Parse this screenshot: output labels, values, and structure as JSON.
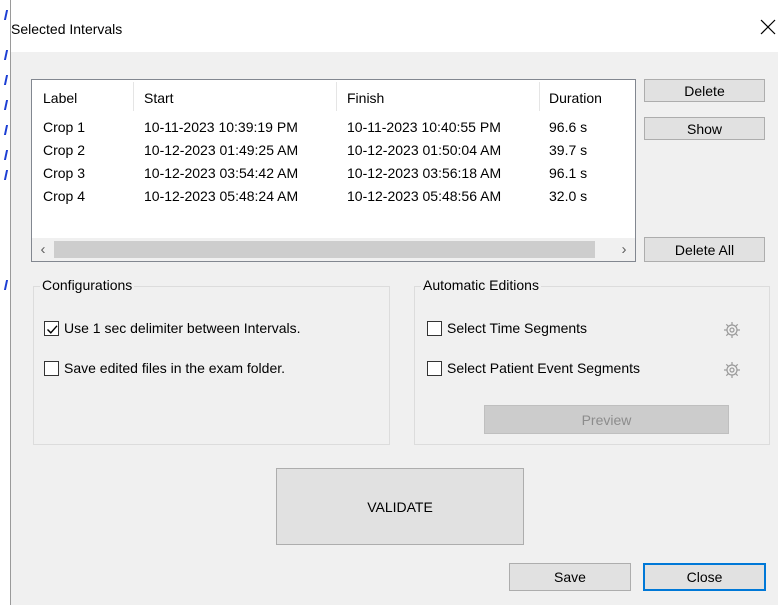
{
  "window": {
    "title": "Selected Intervals"
  },
  "intervals": {
    "columns": [
      "Label",
      "Start",
      "Finish",
      "Duration"
    ],
    "rows": [
      {
        "label": "Crop 1",
        "start": "10-11-2023 10:39:19 PM",
        "finish": "10-11-2023 10:40:55 PM",
        "duration": "96.6 s"
      },
      {
        "label": "Crop 2",
        "start": "10-12-2023 01:49:25 AM",
        "finish": "10-12-2023 01:50:04 AM",
        "duration": "39.7 s"
      },
      {
        "label": "Crop 3",
        "start": "10-12-2023 03:54:42 AM",
        "finish": "10-12-2023 03:56:18 AM",
        "duration": "96.1 s"
      },
      {
        "label": "Crop 4",
        "start": "10-12-2023 05:48:24 AM",
        "finish": "10-12-2023 05:48:56 AM",
        "duration": "32.0 s"
      }
    ]
  },
  "buttons": {
    "delete": "Delete",
    "show": "Show",
    "delete_all": "Delete All",
    "preview": "Preview",
    "validate": "VALIDATE",
    "save": "Save",
    "close": "Close"
  },
  "configurations": {
    "title": "Configurations",
    "use_delimiter": {
      "label": "Use 1 sec delimiter between Intervals.",
      "checked": true
    },
    "save_in_exam_folder": {
      "label": "Save edited files in the exam folder.",
      "checked": false
    }
  },
  "automatic_editions": {
    "title": "Automatic Editions",
    "time_segments": {
      "label": "Select Time Segments",
      "checked": false,
      "icon": "gear-icon"
    },
    "patient_event_segments": {
      "label": "Select Patient Event Segments",
      "checked": false,
      "icon": "gear-icon"
    }
  },
  "colors": {
    "focus_border": "#0078d7",
    "dialog_bg": "#f0f0f0",
    "button_bg": "#e1e1e1"
  }
}
